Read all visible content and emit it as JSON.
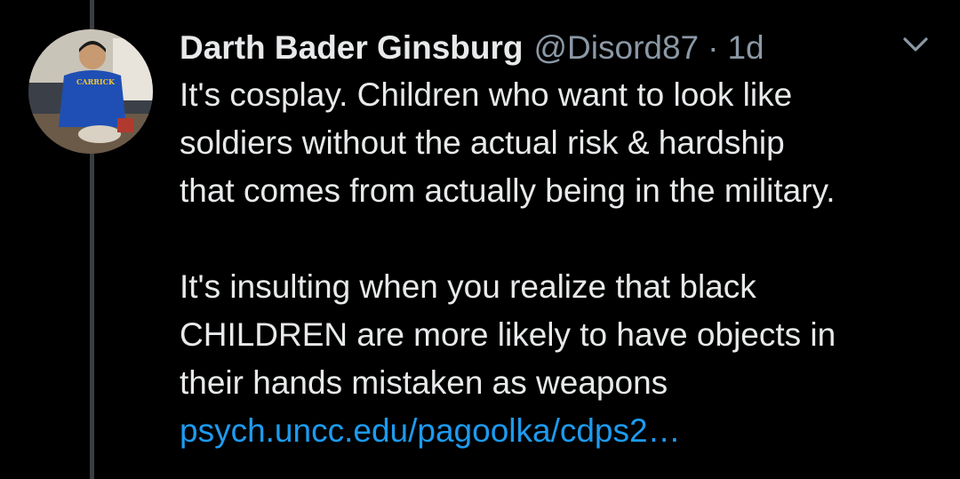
{
  "tweet": {
    "display_name": "Darth Bader Ginsburg",
    "handle": "@Disord87",
    "separator": "·",
    "time": "1d",
    "avatar_shirt_text": "CARRICK",
    "menu_icon": "chevron-down-icon",
    "body_lines_1": [
      "It's cosplay. Children who want to look like",
      "soldiers without the actual risk & hardship",
      "that comes from actually being in the military."
    ],
    "body_lines_2": [
      "It's insulting when you realize that black",
      "CHILDREN are more likely to have objects in",
      "their hands mistaken as weapons"
    ],
    "link_text": "psych.uncc.edu/pagoolka/cdps2…"
  },
  "colors": {
    "background": "#000000",
    "text_primary": "#e7e9ea",
    "text_secondary": "#8b98a5",
    "link": "#1d9bf0",
    "thread_line": "#3a3d41"
  }
}
